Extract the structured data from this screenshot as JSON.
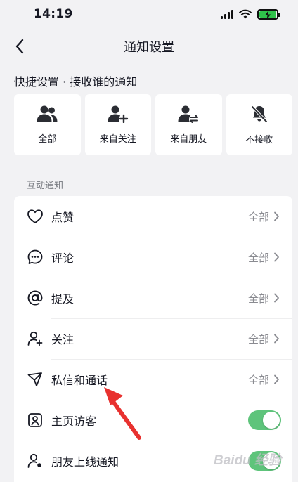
{
  "status_bar": {
    "time": "14:19"
  },
  "nav": {
    "title": "通知设置"
  },
  "quick_settings": {
    "title": "快捷设置 · 接收谁的通知",
    "options": [
      {
        "label": "全部",
        "icon": "users-icon"
      },
      {
        "label": "来自关注",
        "icon": "user-plus-icon"
      },
      {
        "label": "来自朋友",
        "icon": "user-swap-icon"
      },
      {
        "label": "不接收",
        "icon": "bell-off-icon"
      }
    ]
  },
  "interaction": {
    "title": "互动通知",
    "rows": [
      {
        "label": "点赞",
        "value": "全部",
        "icon": "heart-icon"
      },
      {
        "label": "评论",
        "value": "全部",
        "icon": "comment-icon"
      },
      {
        "label": "提及",
        "value": "全部",
        "icon": "at-icon"
      },
      {
        "label": "关注",
        "value": "全部",
        "icon": "follow-icon"
      },
      {
        "label": "私信和通话",
        "value": "全部",
        "icon": "send-icon"
      },
      {
        "label": "主页访客",
        "toggle": true,
        "icon": "profile-icon"
      },
      {
        "label": "朋友上线通知",
        "toggle": true,
        "icon": "friend-online-icon"
      }
    ]
  },
  "watermark": {
    "text": "Baidu 经验"
  },
  "colors": {
    "accent_green": "#5ec47b",
    "annotation_red": "#e8312f"
  }
}
